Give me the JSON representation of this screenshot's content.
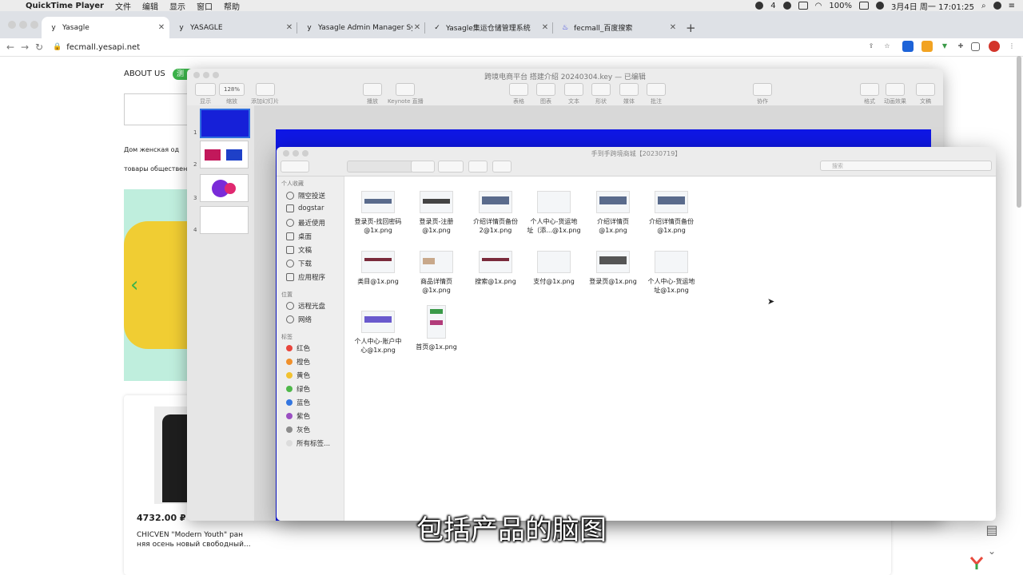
{
  "menubar": {
    "app": "QuickTime Player",
    "items": [
      "文件",
      "编辑",
      "显示",
      "窗口",
      "帮助"
    ],
    "badge": "4",
    "battery": "100%",
    "datetime": "3月4日 周一  17:01:25"
  },
  "tabs": [
    {
      "icon": "y",
      "title": "Yasagle"
    },
    {
      "icon": "y",
      "title": "YASAGLE"
    },
    {
      "icon": "y",
      "title": "Yasagle Admin Manager Syste"
    },
    {
      "icon": "✓",
      "title": "Yasagle集运仓储管理系统"
    },
    {
      "icon": "♨",
      "title": "fecmall_百度搜索"
    }
  ],
  "address": {
    "url": "fecmall.yesapi.net"
  },
  "webpage": {
    "about": "ABOUT US",
    "pill": "测",
    "nav1": "Дом        женская од",
    "nav2": "товары общественно",
    "price": "4732.00 ₽",
    "product_name": "CHICVEN \"Modern Youth\" ран няя осень новый свободный..."
  },
  "keynote": {
    "title": "跨境电商平台 搭建介绍 20240304.key — 已编辑",
    "toolbar": [
      {
        "label": "显示"
      },
      {
        "label": "缩放"
      },
      {
        "label": "添加幻灯片"
      },
      {
        "label": "播放"
      },
      {
        "label": "Keynote 直播"
      },
      {
        "label": "表格"
      },
      {
        "label": "图表"
      },
      {
        "label": "文本"
      },
      {
        "label": "形状"
      },
      {
        "label": "媒体"
      },
      {
        "label": "批注"
      },
      {
        "label": "协作"
      },
      {
        "label": "格式"
      },
      {
        "label": "动画效果"
      },
      {
        "label": "文稿"
      }
    ],
    "zoom": "128%",
    "slides": [
      "1",
      "2",
      "3",
      "4"
    ]
  },
  "finder": {
    "title": "手到手跨境商城【20230719】",
    "search_placeholder": "搜索",
    "sections": {
      "favorites": "个人收藏",
      "locations": "位置",
      "tags": "标签"
    },
    "favorites": [
      "隔空投送",
      "dogstar",
      "最近使用",
      "桌面",
      "文稿",
      "下载",
      "应用程序"
    ],
    "locations": [
      "远程光盘",
      "网络"
    ],
    "tags": [
      {
        "label": "红色",
        "color": "#e8453c"
      },
      {
        "label": "橙色",
        "color": "#f0902c"
      },
      {
        "label": "黄色",
        "color": "#f2c230"
      },
      {
        "label": "绿色",
        "color": "#4fb84a"
      },
      {
        "label": "蓝色",
        "color": "#3476e0"
      },
      {
        "label": "紫色",
        "color": "#9a4fc2"
      },
      {
        "label": "灰色",
        "color": "#8c8c8c"
      },
      {
        "label": "所有标签...",
        "color": "#dcdcdc"
      }
    ],
    "files": [
      [
        "登录页-找回密码",
        "@1x.png"
      ],
      [
        "登录页-注册",
        "@1x.png"
      ],
      [
        "介绍详情页备份",
        "2@1x.png"
      ],
      [
        "个人中心-货运地",
        "址（添...@1x.png"
      ],
      [
        "介绍详情页",
        "@1x.png"
      ],
      [
        "介绍详情页备份",
        "@1x.png"
      ],
      [
        "类目@1x.png",
        ""
      ],
      [
        "商品详情页",
        "@1x.png"
      ],
      [
        "搜索@1x.png",
        ""
      ],
      [
        "支付@1x.png",
        ""
      ],
      [
        "登录页@1x.png",
        ""
      ],
      [
        "个人中心-货运地",
        "址@1x.png"
      ],
      [
        "个人中心-账户中",
        "心@1x.png"
      ],
      [
        "首页@1x.png",
        ""
      ]
    ]
  },
  "subtitle": "包括产品的脑图"
}
